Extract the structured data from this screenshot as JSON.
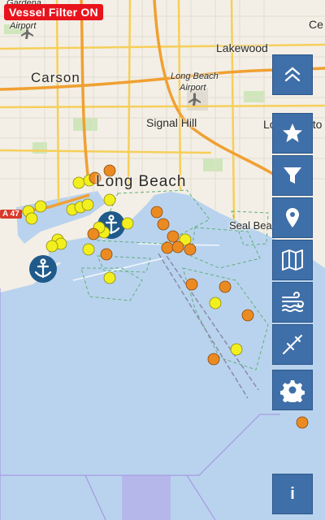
{
  "status_badge": "Vessel Filter ON",
  "labels": {
    "gardena": "Gardena",
    "airport_top": "Airport",
    "carson": "Carson",
    "lakewood": "Lakewood",
    "cerritos_fragment": "Ce",
    "long_beach_airport_1": "Long Beach",
    "long_beach_airport_2": "Airport",
    "signal_hill": "Signal Hill",
    "los_alamitos": "Los Alamito",
    "long_beach_city": "Long Beach",
    "seal_beach": "Seal Beach",
    "route_47": "A 47"
  },
  "controls": {
    "collapse": "collapse-icon",
    "favorites": "star-icon",
    "filter": "filter-icon",
    "location": "pin-icon",
    "map_layers": "map-icon",
    "weather": "wind-icon",
    "measure": "compass-icon",
    "settings": "gear-icon",
    "info_label": "i"
  },
  "colors": {
    "water": "#b9d3ee",
    "land": "#f3efe6",
    "button": "#3f6fa8",
    "badge": "#e8131c",
    "vessel_yellow": "#f2ef1f",
    "vessel_orange": "#ec8a22",
    "anchorage": "#1f5a8a"
  },
  "vessels": {
    "yellow_count": 27,
    "orange_count": 19,
    "anchorage_markers": 2
  }
}
